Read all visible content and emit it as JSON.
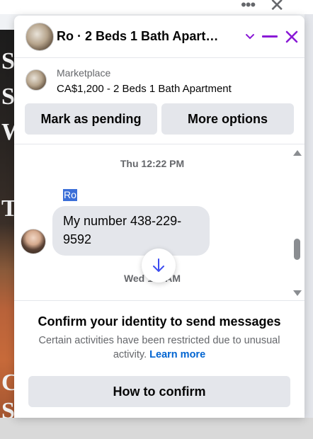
{
  "background": {
    "more_icon": "•••",
    "close_icon": "✕",
    "letters": [
      "S",
      "S",
      "W",
      "T",
      "C",
      "S"
    ]
  },
  "chat": {
    "title": "Ro · 2 Beds 1 Bath Apartm…",
    "accent_color": "#8a19d6",
    "marketplace_label": "Marketplace",
    "listing_text": "CA$1,200 - 2 Beds 1 Bath Apartment",
    "actions": {
      "mark_pending": "Mark as pending",
      "more_options": "More options"
    },
    "messages": {
      "timestamp_1": "Thu 12:22 PM",
      "sender_name": "Ro",
      "message_text": "My number 438-229-9592",
      "timestamp_2": "Wed 1… AM"
    },
    "footer": {
      "title": "Confirm your identity to send messages",
      "description": "Certain activities have been restricted due to unusual activity.",
      "learn_more": "Learn more",
      "confirm_button": "How to confirm"
    }
  }
}
